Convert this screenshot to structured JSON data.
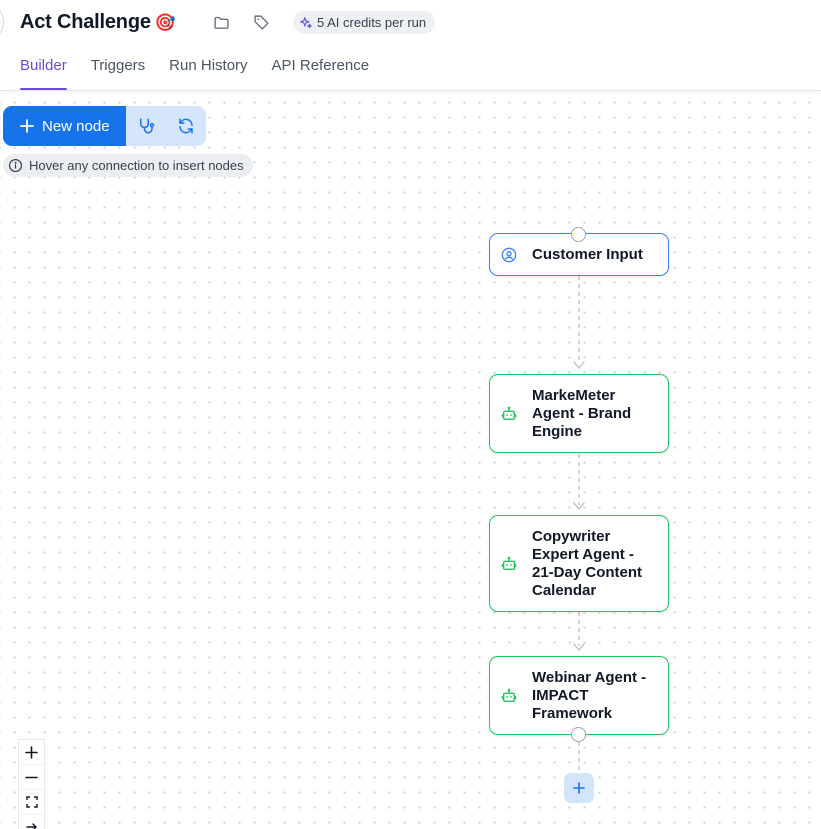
{
  "header": {
    "title": "Act Challenge",
    "emoji": "🎯",
    "credits_label": "5 AI credits per run"
  },
  "tabs": [
    {
      "label": "Builder",
      "active": true
    },
    {
      "label": "Triggers",
      "active": false
    },
    {
      "label": "Run History",
      "active": false
    },
    {
      "label": "API Reference",
      "active": false
    }
  ],
  "toolbar": {
    "new_node_label": "New node",
    "hint": "Hover any connection to insert nodes"
  },
  "nodes": [
    {
      "label": "Customer Input",
      "kind": "input",
      "icon": "user-circle-icon"
    },
    {
      "label": "MarkeMeter Agent - Brand Engine",
      "kind": "agent",
      "icon": "robot-icon"
    },
    {
      "label": "Copywriter Expert Agent - 21-Day Content Calendar",
      "kind": "agent",
      "icon": "robot-icon"
    },
    {
      "label": "Webinar Agent - IMPACT Framework",
      "kind": "agent",
      "icon": "robot-icon"
    }
  ],
  "colors": {
    "accent": "#6d4bd6",
    "primary": "#1673ea",
    "input_border": "#3b82f6",
    "agent_border": "#22c55e"
  }
}
